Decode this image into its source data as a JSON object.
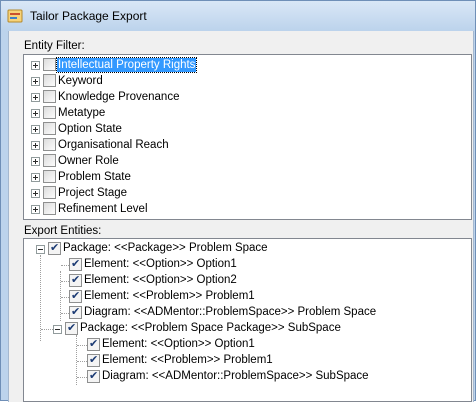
{
  "window": {
    "title": "Tailor Package Export"
  },
  "entity_filter": {
    "label": "Entity Filter:",
    "items": [
      {
        "label": "Intellectual Property Rights",
        "checked": false,
        "selected": true
      },
      {
        "label": "Keyword",
        "checked": false
      },
      {
        "label": "Knowledge Provenance",
        "checked": false
      },
      {
        "label": "Metatype",
        "checked": false
      },
      {
        "label": "Option State",
        "checked": false
      },
      {
        "label": "Organisational Reach",
        "checked": false
      },
      {
        "label": "Owner Role",
        "checked": false
      },
      {
        "label": "Problem State",
        "checked": false
      },
      {
        "label": "Project Stage",
        "checked": false
      },
      {
        "label": "Refinement Level",
        "checked": false
      }
    ]
  },
  "export_entities": {
    "label": "Export Entities:",
    "root": "Package: <<Package>> Problem Space",
    "children": [
      "Element: <<Option>> Option1",
      "Element: <<Option>> Option2",
      "Element: <<Problem>> Problem1",
      "Diagram: <<ADMentor::ProblemSpace>> Problem Space"
    ],
    "subpackage": "Package: <<Problem Space Package>> SubSpace",
    "sub_children": [
      "Element: <<Option>> Option1",
      "Element: <<Problem>> Problem1",
      "Diagram: <<ADMentor::ProblemSpace>> SubSpace"
    ]
  },
  "colors": {
    "selection": "#3399ff",
    "check": "#1b3a73",
    "frame": "#bcd3ec"
  }
}
